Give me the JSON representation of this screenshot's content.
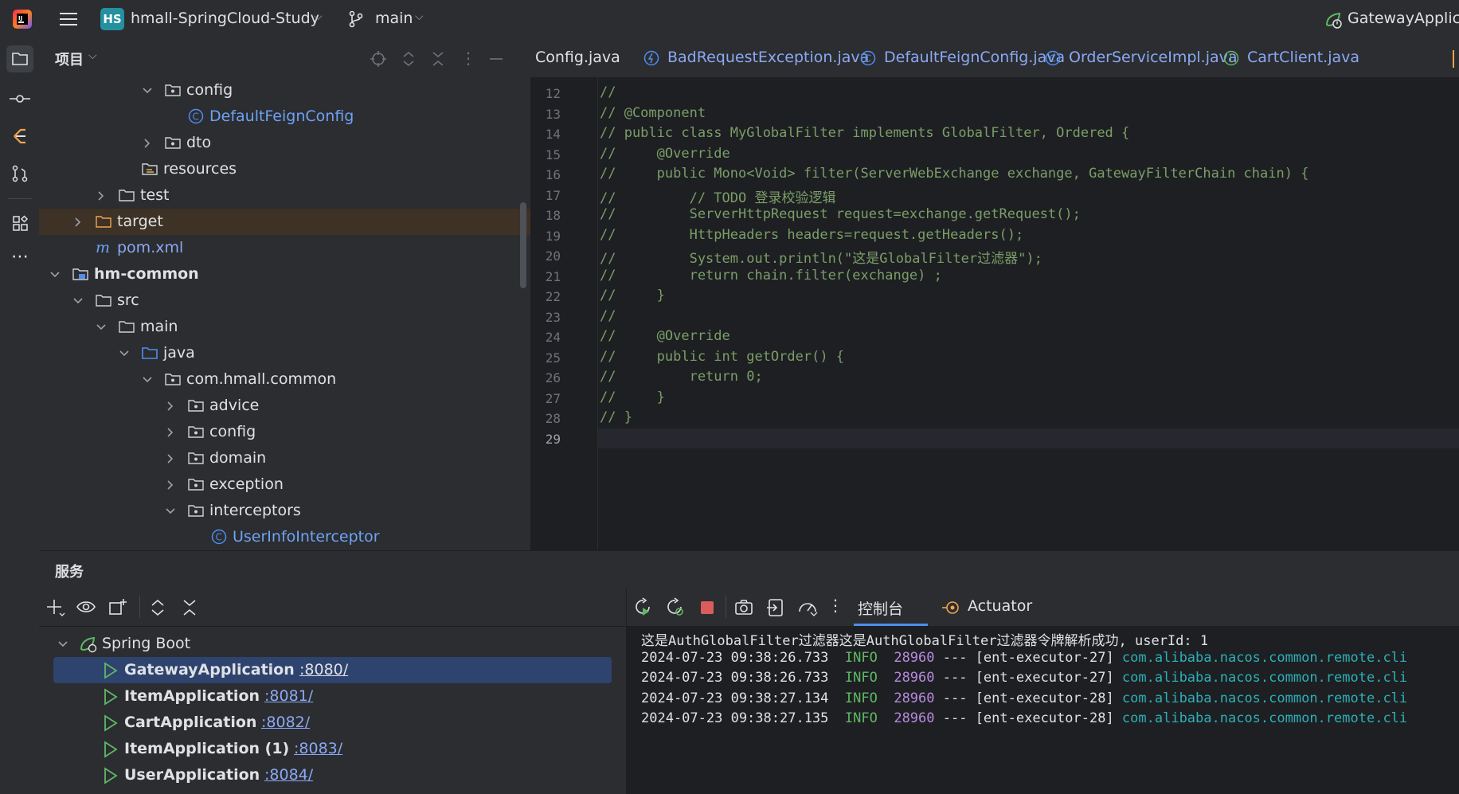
{
  "titlebar": {
    "logo": "intellij-logo-icon",
    "project_badge": "HS",
    "project_name": "hmall-SpringCloud-Study",
    "branch": "main",
    "run_config": "GatewayApplica"
  },
  "project_panel": {
    "title": "项目",
    "tree": [
      {
        "label": "config",
        "kind": "package",
        "expanded": true
      },
      {
        "label": "DefaultFeignConfig",
        "kind": "class"
      },
      {
        "label": "dto",
        "kind": "package",
        "expanded": false
      },
      {
        "label": "resources",
        "kind": "resources"
      },
      {
        "label": "test",
        "kind": "folder",
        "expanded": false
      },
      {
        "label": "target",
        "kind": "folder-orange",
        "expanded": false
      },
      {
        "label": "pom.xml",
        "kind": "maven"
      },
      {
        "label": "hm-common",
        "kind": "module",
        "expanded": true
      },
      {
        "label": "src",
        "kind": "folder",
        "expanded": true
      },
      {
        "label": "main",
        "kind": "folder",
        "expanded": true
      },
      {
        "label": "java",
        "kind": "source-root",
        "expanded": true
      },
      {
        "label": "com.hmall.common",
        "kind": "package",
        "expanded": true
      },
      {
        "label": "advice",
        "kind": "package",
        "expanded": false
      },
      {
        "label": "config",
        "kind": "package",
        "expanded": false
      },
      {
        "label": "domain",
        "kind": "package",
        "expanded": false
      },
      {
        "label": "exception",
        "kind": "package",
        "expanded": false
      },
      {
        "label": "interceptors",
        "kind": "package",
        "expanded": true
      },
      {
        "label": "UserInfoInterceptor",
        "kind": "class"
      }
    ]
  },
  "editor": {
    "tabs": [
      {
        "label": "Config.java",
        "icon": "none"
      },
      {
        "label": "BadRequestException.java",
        "icon": "exception-class-icon"
      },
      {
        "label": "DefaultFeignConfig.java",
        "icon": "class-icon"
      },
      {
        "label": "OrderServiceImpl.java",
        "icon": "class-icon"
      },
      {
        "label": "CartClient.java",
        "icon": "interface-icon"
      }
    ],
    "lines": [
      {
        "n": "12",
        "text": "//"
      },
      {
        "n": "13",
        "text": "// @Component"
      },
      {
        "n": "14",
        "text": "// public class MyGlobalFilter implements GlobalFilter, Ordered {"
      },
      {
        "n": "15",
        "text": "//     @Override"
      },
      {
        "n": "16",
        "text": "//     public Mono<Void> filter(ServerWebExchange exchange, GatewayFilterChain chain) {"
      },
      {
        "n": "17",
        "text": "//         // TODO 登录校验逻辑"
      },
      {
        "n": "18",
        "text": "//         ServerHttpRequest request=exchange.getRequest();"
      },
      {
        "n": "19",
        "text": "//         HttpHeaders headers=request.getHeaders();"
      },
      {
        "n": "20",
        "text": "//         System.out.println(\"这是GlobalFilter过滤器\");"
      },
      {
        "n": "21",
        "text": "//         return chain.filter(exchange) ;"
      },
      {
        "n": "22",
        "text": "//     }"
      },
      {
        "n": "23",
        "text": "//"
      },
      {
        "n": "24",
        "text": "//     @Override"
      },
      {
        "n": "25",
        "text": "//     public int getOrder() {"
      },
      {
        "n": "26",
        "text": "//         return 0;"
      },
      {
        "n": "27",
        "text": "//     }"
      },
      {
        "n": "28",
        "text": "// }"
      },
      {
        "n": "29",
        "text": ""
      }
    ]
  },
  "services": {
    "title": "服务",
    "group": "Spring Boot",
    "apps": [
      {
        "name": "GatewayApplication",
        "port": ":8080/",
        "selected": true
      },
      {
        "name": "ItemApplication",
        "port": ":8081/",
        "selected": false
      },
      {
        "name": "CartApplication",
        "port": ":8082/",
        "selected": false
      },
      {
        "name": "ItemApplication (1)",
        "port": ":8083/",
        "selected": false
      },
      {
        "name": "UserApplication",
        "port": ":8084/",
        "selected": false
      }
    ],
    "console_tab": "控制台",
    "actuator_tab": "Actuator",
    "console_lines": [
      {
        "plain": "这是AuthGlobalFilter过滤器这是AuthGlobalFilter过滤器令牌解析成功, userId: 1"
      },
      {
        "ts": "2024-07-23 09:38:26.733",
        "level": "INFO",
        "pid": "28960",
        "thread": " --- [ent-executor-27] ",
        "logger": "com.alibaba.nacos.common.remote.cli"
      },
      {
        "ts": "2024-07-23 09:38:26.733",
        "level": "INFO",
        "pid": "28960",
        "thread": " --- [ent-executor-27] ",
        "logger": "com.alibaba.nacos.common.remote.cli"
      },
      {
        "ts": "2024-07-23 09:38:27.134",
        "level": "INFO",
        "pid": "28960",
        "thread": " --- [ent-executor-28] ",
        "logger": "com.alibaba.nacos.common.remote.cli"
      },
      {
        "ts": "2024-07-23 09:38:27.135",
        "level": "INFO",
        "pid": "28960",
        "thread": " --- [ent-executor-28] ",
        "logger": "com.alibaba.nacos.common.remote.cli"
      }
    ]
  },
  "colors": {
    "accent": "#4e8dee",
    "selection": "#2e436e",
    "comment": "#7a9e68",
    "info": "#5fb865",
    "pid": "#b889e0",
    "logger": "#2bb0b7"
  }
}
